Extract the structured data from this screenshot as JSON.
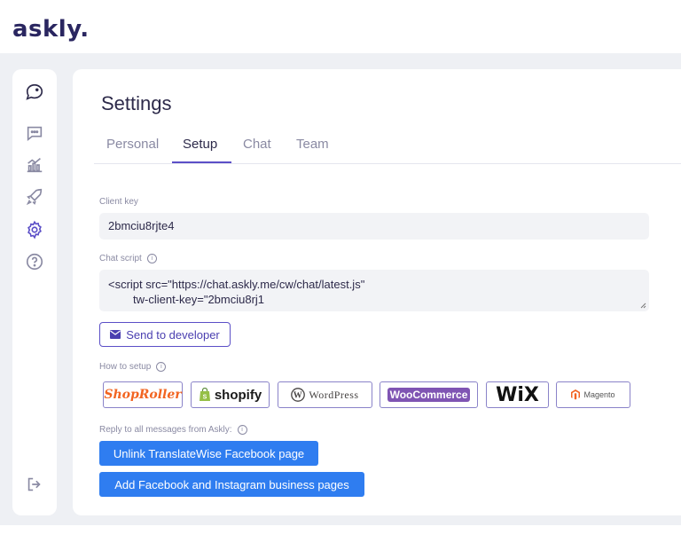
{
  "brand": {
    "logo_text": "askly."
  },
  "sidebar": {
    "items": [
      {
        "icon": "chat-bubble-icon"
      },
      {
        "icon": "messages-icon"
      },
      {
        "icon": "stats-icon"
      },
      {
        "icon": "rocket-icon"
      },
      {
        "icon": "gear-icon",
        "active": true
      },
      {
        "icon": "help-icon"
      },
      {
        "icon": "logout-icon"
      }
    ]
  },
  "settings": {
    "title": "Settings",
    "tabs": [
      {
        "label": "Personal",
        "active": false
      },
      {
        "label": "Setup",
        "active": true
      },
      {
        "label": "Chat",
        "active": false
      },
      {
        "label": "Team",
        "active": false
      }
    ],
    "client_key_label": "Client key",
    "client_key_value": "2bmciu8rjte4",
    "chat_script_label": "Chat script",
    "chat_script_line1": "<script src=\"https://chat.askly.me/cw/chat/latest.js\"",
    "chat_script_line2": "tw-client-key=\"2bmciu8rj1",
    "send_button_label": "Send to developer",
    "how_to_setup_label": "How to setup",
    "platforms": [
      "ShopRoller",
      "shopify",
      "WordPress",
      "WooCommerce",
      "WiX",
      "Magento"
    ],
    "reply_label": "Reply to all messages from Askly:",
    "unlink_button_label": "Unlink TranslateWise Facebook page",
    "add_button_label": "Add Facebook and Instagram business pages"
  },
  "colors": {
    "accent": "#5b4fc7",
    "primary_button": "#2f7df0",
    "text_dark": "#2d2a4a",
    "text_muted": "#8a8aa3"
  }
}
